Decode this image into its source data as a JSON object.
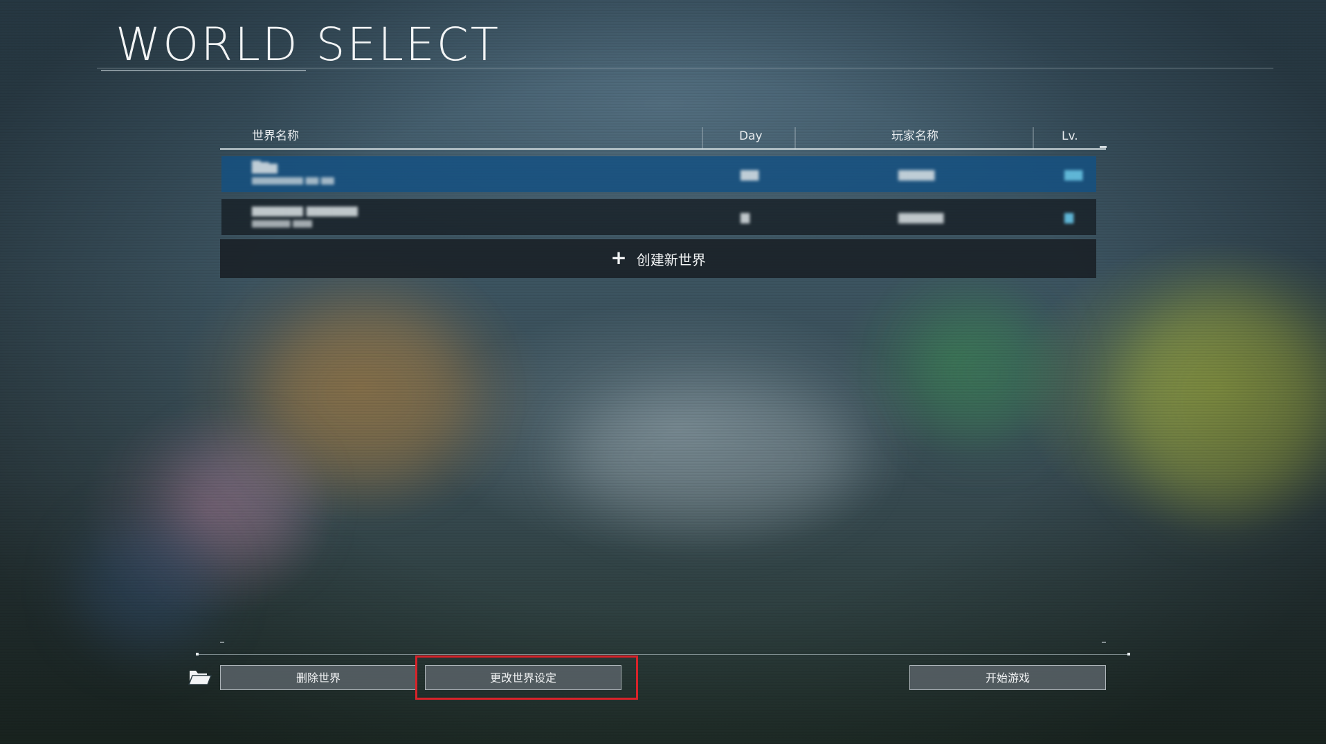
{
  "page": {
    "title": "WORLD SELECT"
  },
  "table": {
    "headers": {
      "world_name": "世界名称",
      "day": "Day",
      "player_name": "玩家名称",
      "level": "Lv."
    },
    "rows": [
      {
        "world_name": "█▇▆",
        "subtitle": "▆▆▆▆▆▆▆▆ ▆▆:▆▆",
        "day": "▆▆",
        "player_name": "▆▆▆▆",
        "level": "▆▆",
        "selected": true
      },
      {
        "world_name": "▆▆▆▆▆▆ ▆▆▆▆▆▆",
        "subtitle": "▆▆▆▆▆▆ ▆▆▆",
        "day": "▆",
        "player_name": "▆▆▆▆▆",
        "level": "▆",
        "selected": false
      }
    ],
    "create_new_world": "创建新世界"
  },
  "footer": {
    "delete_world": "删除世界",
    "change_world_settings": "更改世界设定",
    "start_game": "开始游戏"
  },
  "colors": {
    "selected_row": "#14508a",
    "highlight_box": "#d8232a",
    "level_text": "#5fb6d6"
  },
  "icons": {
    "folder": "folder-open-icon",
    "plus": "plus-icon"
  }
}
